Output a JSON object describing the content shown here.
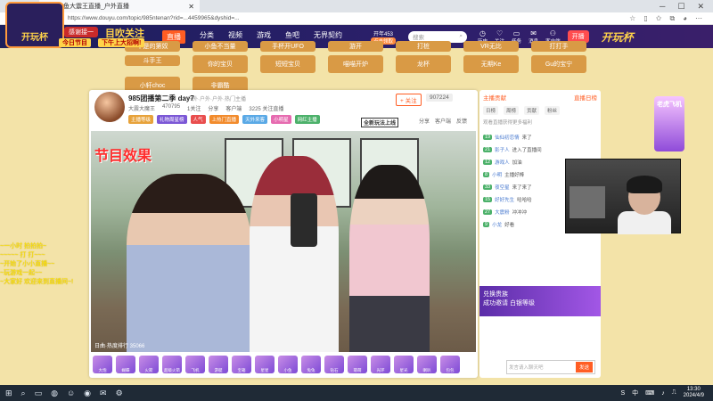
{
  "browser": {
    "tab_title": "斗鱼大震王直播_户外直播",
    "url": "https://www.douyu.com/topic/985ntenan?rid=...4459965&dyshid=...",
    "window_controls": [
      "─",
      "☐",
      "✕"
    ]
  },
  "overlay": {
    "logo_text": "开玩杯",
    "hot_title": "目吹关注",
    "welcome_label": "感谢接一",
    "today_label": "今日节目",
    "today_value": "下午上大招啊!",
    "side_lines": [
      "~一小时 拍拍拍~",
      "~~~~~ 打 打~~~",
      "~开始了小小直播~~",
      "~玩游戏一起~~",
      "~大家好 欢迎来到直播间~!"
    ]
  },
  "site_nav": {
    "items": [
      "直播",
      "分类",
      "视频",
      "游戏",
      "鱼吧",
      "无界契约"
    ],
    "active_index": 0,
    "promo_top": "开年453",
    "promo_bottom": "点击领取",
    "search_placeholder": "搜索",
    "user_icons": [
      {
        "glyph": "◷",
        "label": "历史"
      },
      {
        "glyph": "♡",
        "label": "关注"
      },
      {
        "glyph": "▭",
        "label": "任务"
      },
      {
        "glyph": "✉",
        "label": "消息"
      },
      {
        "glyph": "⚇",
        "label": "客户端"
      }
    ],
    "live_button": "开播",
    "brand": "开玩杯"
  },
  "categories": {
    "row1": [
      "不是的第奴",
      "小鱼不当量",
      "手杯开UFO",
      "游开",
      "打桩",
      "VR无比",
      "打打手",
      "斗手王"
    ],
    "row2": [
      "你的宝贝",
      "短短宝贝",
      "喵喵开炉",
      "龙杯",
      "无期Ke",
      "Gu的宝宁",
      "小轩choc",
      "非霸酷"
    ]
  },
  "room": {
    "title": "985团播第二季 day7",
    "subtitle": "户外·户外·户外·热门主播",
    "anchor_name": "大震大魔王",
    "meta": [
      "470795",
      "1关注",
      "分享",
      "客户端",
      "3225 关注直播"
    ],
    "tags": [
      "主播等级",
      "礼物周星榜",
      "人气",
      "上热门直播",
      "天外来客",
      "小明星",
      "网红主播"
    ],
    "follow_label": "+ 关注",
    "fans_count": "907224",
    "actions": [
      "分享",
      "客户端",
      "反馈"
    ],
    "new_badge": "全新玩法上线",
    "overlay_label": "节目效果",
    "footer_stat": "日曲·热度排行 35066"
  },
  "gifts": [
    "大炮",
    "蝴蝶",
    "火箭",
    "超级火箭",
    "飞机",
    "游艇",
    "宝箱",
    "星星",
    "小鱼",
    "兔兔",
    "钻石",
    "萌萌",
    "光环",
    "星光",
    "喇叭",
    "包包"
  ],
  "rank_panel": {
    "tabs": [
      "主播贡献",
      "直播日榜"
    ],
    "sub_tabs": [
      "日榜",
      "周榜",
      "贡献",
      "粉丝"
    ],
    "note": "观看直播获得更多福利",
    "messages": [
      {
        "lvl": "19",
        "name": "仙仙初恋情",
        "text": "来了"
      },
      {
        "lvl": "21",
        "name": "影子人",
        "text": "进入了直播间"
      },
      {
        "lvl": "12",
        "name": "游戏人",
        "text": "加油"
      },
      {
        "lvl": "8",
        "name": "小明",
        "text": "主播好棒"
      },
      {
        "lvl": "33",
        "name": "夜空星",
        "text": "来了来了"
      },
      {
        "lvl": "15",
        "name": "好好先生",
        "text": "哈哈哈"
      },
      {
        "lvl": "27",
        "name": "大震粉",
        "text": "冲冲冲"
      },
      {
        "lvl": "9",
        "name": "小龙",
        "text": "好看"
      }
    ],
    "banner_line1": "兑换贵族",
    "banner_line2": "成功邀请 白银等级",
    "input_placeholder": "发言请入聊天吧",
    "send_label": "发送"
  },
  "right_ad": "老虎飞机",
  "taskbar": {
    "items": [
      "⊞",
      "⌕",
      "▭",
      "◍",
      "☺",
      "◉",
      "✉",
      "⚙"
    ],
    "tray_icons": [
      "S",
      "中",
      "⌨",
      "♪",
      "⎍"
    ],
    "time": "13:30",
    "date": "2024/4/9"
  }
}
